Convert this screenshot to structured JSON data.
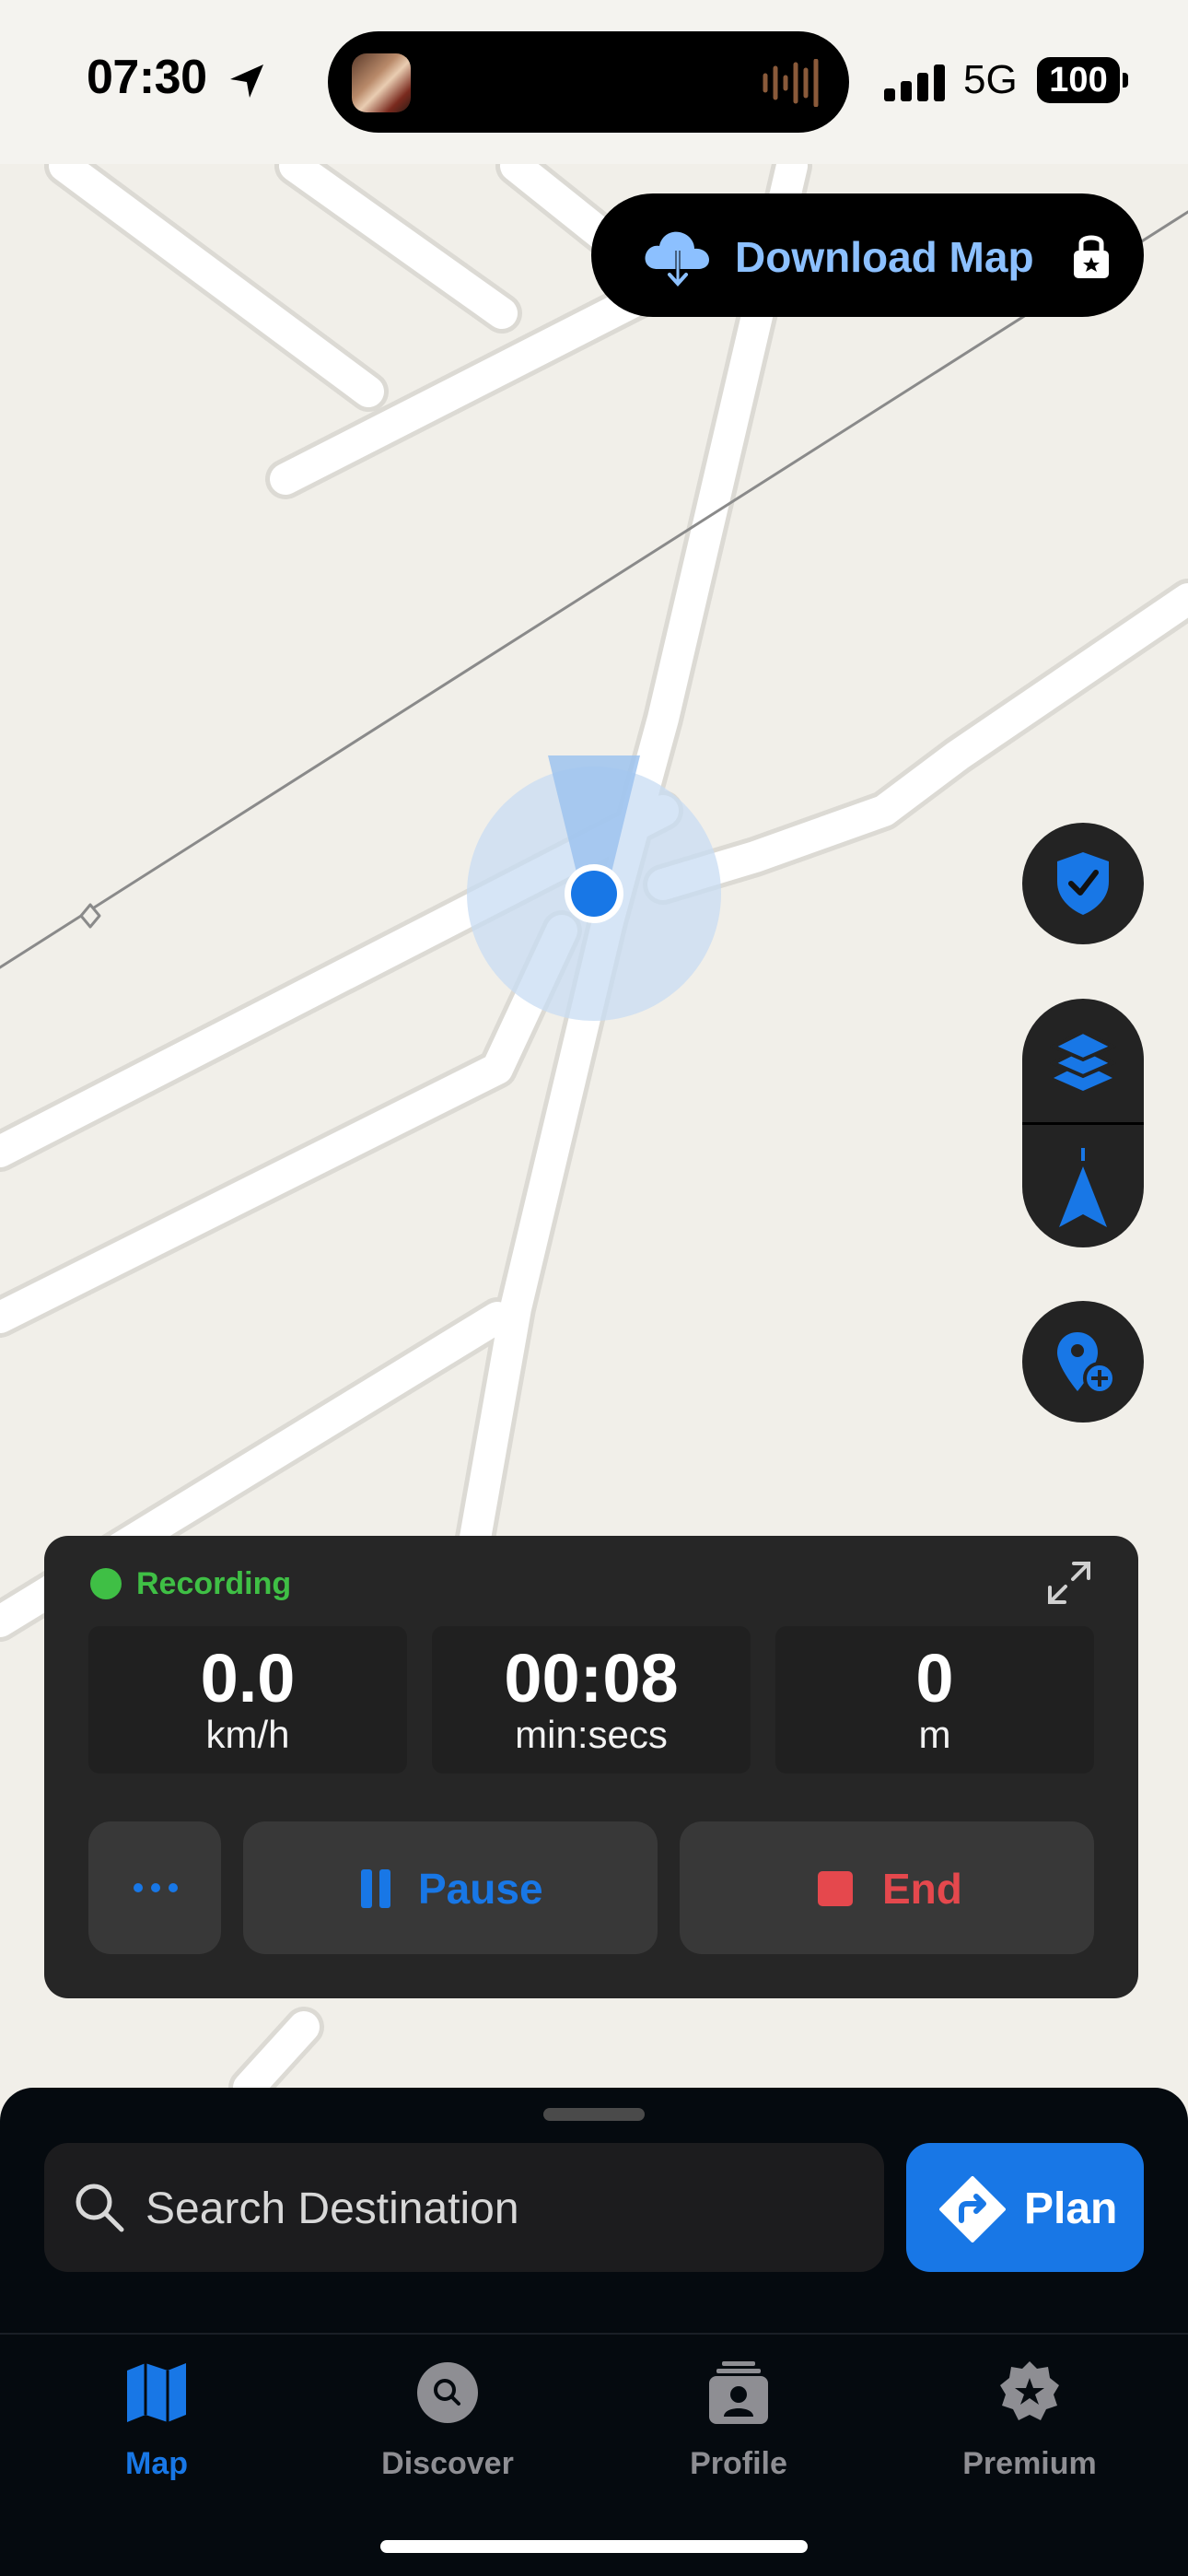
{
  "status_bar": {
    "time": "07:30",
    "network": "5G",
    "battery": "100"
  },
  "map": {
    "download_button": {
      "label": "Download Map",
      "icon": "cloud-download-icon",
      "lock_icon": "lock-star-icon"
    },
    "controls": [
      "shield-check-icon",
      "layers-icon",
      "compass-arrow-icon",
      "add-pin-icon"
    ]
  },
  "recording": {
    "status": "Recording",
    "stats": [
      {
        "value": "0.0",
        "unit": "km/h"
      },
      {
        "value": "00:08",
        "unit": "min:secs"
      },
      {
        "value": "0",
        "unit": "m"
      }
    ],
    "more_label": "...",
    "pause_label": "Pause",
    "end_label": "End"
  },
  "search": {
    "placeholder": "Search Destination",
    "plan_label": "Plan"
  },
  "tabs": [
    {
      "label": "Map",
      "icon": "map-icon",
      "active": true
    },
    {
      "label": "Discover",
      "icon": "discover-icon",
      "active": false
    },
    {
      "label": "Profile",
      "icon": "profile-icon",
      "active": false
    },
    {
      "label": "Premium",
      "icon": "premium-star-icon",
      "active": false
    }
  ],
  "colors": {
    "accent": "#1877e6",
    "recording_green": "#3fbf45",
    "end_red": "#e5484d",
    "map_background": "#f1efe9"
  }
}
